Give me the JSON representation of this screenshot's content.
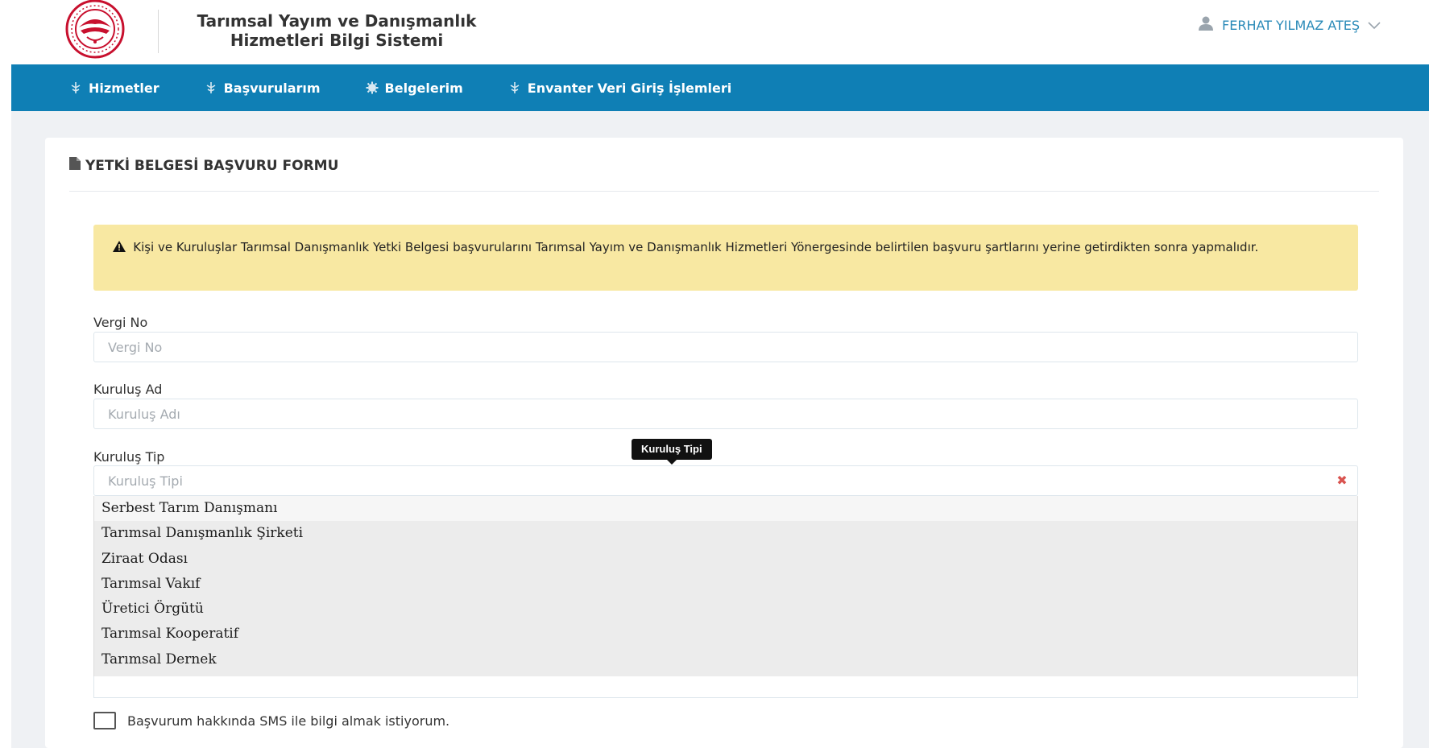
{
  "header": {
    "app_title": "Tarımsal Yayım ve Danışmanlık Hizmetleri Bilgi Sistemi",
    "user_name": "FERHAT YILMAZ ATEŞ"
  },
  "nav": {
    "items": [
      {
        "label": "Hizmetler",
        "icon": "leaf-icon"
      },
      {
        "label": "Başvurularım",
        "icon": "leaf-icon"
      },
      {
        "label": "Belgelerim",
        "icon": "gear-icon"
      },
      {
        "label": "Envanter Veri Giriş İşlemleri",
        "icon": "leaf-icon"
      }
    ]
  },
  "form": {
    "title": "YETKİ BELGESİ BAŞVURU FORMU",
    "alert": "Kişi ve Kuruluşlar Tarımsal Danışmanlık Yetki Belgesi başvurularını Tarımsal Yayım ve Danışmanlık Hizmetleri Yönergesinde belirtilen başvuru şartlarını yerine getirdikten sonra yapmalıdır.",
    "fields": {
      "vergi_no": {
        "label": "Vergi No",
        "placeholder": "Vergi No"
      },
      "kurulus_ad": {
        "label": "Kuruluş Ad",
        "placeholder": "Kuruluş Adı"
      },
      "kurulus_tip": {
        "label": "Kuruluş Tip",
        "placeholder": "Kuruluş Tipi",
        "tooltip": "Kuruluş Tipi"
      }
    },
    "kurulus_tip_options": [
      "Serbest Tarım Danışmanı",
      "Tarımsal Danışmanlık Şirketi",
      "Ziraat Odası",
      "Tarımsal Vakıf",
      "Üretici Örgütü",
      "Tarımsal Kooperatif",
      "Tarımsal Dernek"
    ],
    "sms_label": "Başvurum hakkında SMS ile bilgi almak istiyorum."
  },
  "colors": {
    "nav_bg": "#0f7fb5",
    "alert_bg": "#f8e8a2",
    "user_link": "#2a8ab8",
    "clear_x": "#d9534f"
  }
}
